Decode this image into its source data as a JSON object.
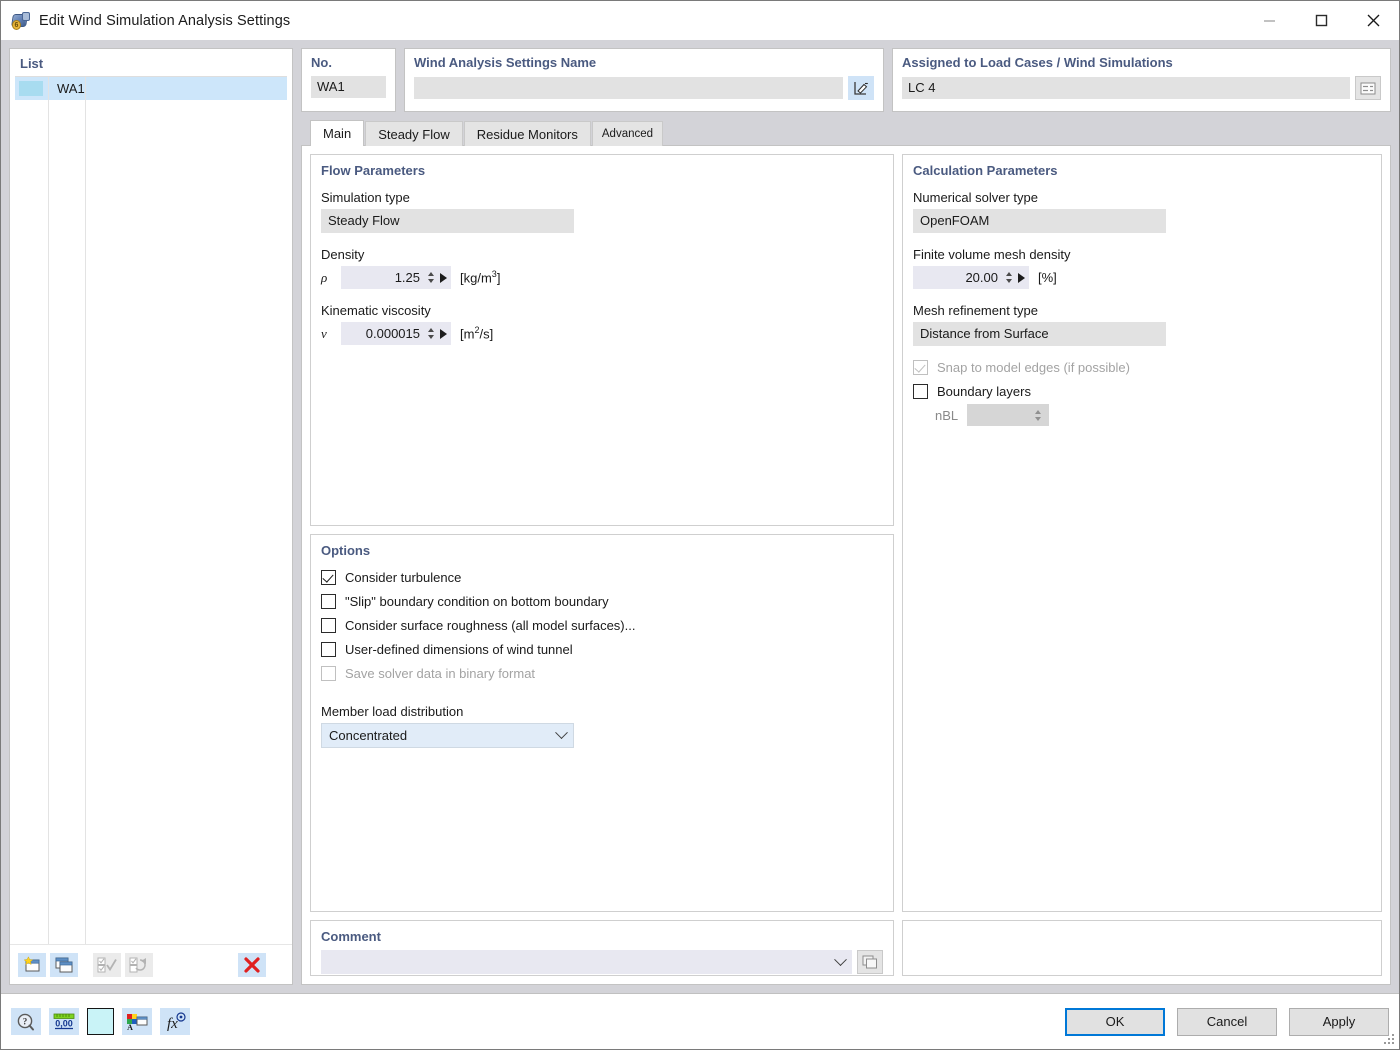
{
  "window": {
    "title": "Edit Wind Simulation Analysis Settings",
    "icon": "wind-simulation-icon",
    "minimize_label": "—",
    "maximize_label": "□",
    "close_label": "✕"
  },
  "list_panel": {
    "title": "List",
    "rows": [
      {
        "color": "#a8dcf0",
        "label": "WA1"
      }
    ],
    "toolbar": [
      {
        "name": "new-settings-button",
        "tooltip": "New",
        "enabled": true
      },
      {
        "name": "copy-settings-button",
        "tooltip": "Copy",
        "enabled": true
      },
      {
        "name": "select-all-button",
        "tooltip": "Select All",
        "enabled": false
      },
      {
        "name": "invert-selection-button",
        "tooltip": "Invert Selection",
        "enabled": false
      },
      {
        "name": "delete-settings-button",
        "tooltip": "Delete",
        "enabled": true
      }
    ]
  },
  "header": {
    "no_label": "No.",
    "no_value": "WA1",
    "name_label": "Wind Analysis Settings Name",
    "name_value": "",
    "assigned_label": "Assigned to Load Cases / Wind Simulations",
    "assigned_value": "LC 4"
  },
  "tabs": [
    {
      "label": "Main",
      "active": true,
      "small": false
    },
    {
      "label": "Steady Flow",
      "active": false,
      "small": false
    },
    {
      "label": "Residue Monitors",
      "active": false,
      "small": false
    },
    {
      "label": "Advanced",
      "active": false,
      "small": true
    }
  ],
  "flow_parameters": {
    "title": "Flow Parameters",
    "simulation_type_label": "Simulation type",
    "simulation_type_value": "Steady Flow",
    "density_label": "Density",
    "density_symbol": "ρ",
    "density_value": "1.25",
    "density_unit_pre": "[kg/m",
    "density_unit_sup": "3",
    "density_unit_post": "]",
    "viscosity_label": "Kinematic viscosity",
    "viscosity_symbol": "ν",
    "viscosity_value": "0.000015",
    "viscosity_unit_pre": "[m",
    "viscosity_unit_sup": "2",
    "viscosity_unit_post": "/s]"
  },
  "options": {
    "title": "Options",
    "items": [
      {
        "label": "Consider turbulence",
        "checked": true,
        "enabled": true
      },
      {
        "label": "\"Slip\" boundary condition on bottom boundary",
        "checked": false,
        "enabled": true
      },
      {
        "label": "Consider surface roughness (all model surfaces)...",
        "checked": false,
        "enabled": true
      },
      {
        "label": "User-defined dimensions of wind tunnel",
        "checked": false,
        "enabled": true
      },
      {
        "label": "Save solver data in binary format",
        "checked": false,
        "enabled": false
      }
    ],
    "member_load_label": "Member load distribution",
    "member_load_value": "Concentrated"
  },
  "calculation_parameters": {
    "title": "Calculation Parameters",
    "solver_label": "Numerical solver type",
    "solver_value": "OpenFOAM",
    "mesh_density_label": "Finite volume mesh density",
    "mesh_density_value": "20.00",
    "mesh_density_unit": "[%]",
    "refinement_label": "Mesh refinement type",
    "refinement_value": "Distance from Surface",
    "snap_label": "Snap to model edges (if possible)",
    "snap_checked": true,
    "snap_enabled": false,
    "boundary_label": "Boundary layers",
    "boundary_checked": false,
    "nbl_label": "nBL",
    "nbl_value": ""
  },
  "comment": {
    "title": "Comment",
    "value": ""
  },
  "bottom_toolbar": [
    {
      "name": "help-info-icon"
    },
    {
      "name": "units-decimal-icon"
    },
    {
      "name": "color-swatch-icon"
    },
    {
      "name": "text-style-icon"
    },
    {
      "name": "formula-icon"
    }
  ],
  "buttons": {
    "ok": "OK",
    "cancel": "Cancel",
    "apply": "Apply"
  },
  "colors": {
    "accent_blue": "#0078d7",
    "group_title": "#4a5a80",
    "selection": "#cde6fa",
    "readonly_field": "#e2e2e2",
    "spin_field": "#e8e8f1",
    "combo_field": "#e1ecf8",
    "delete_red": "#e02020"
  }
}
